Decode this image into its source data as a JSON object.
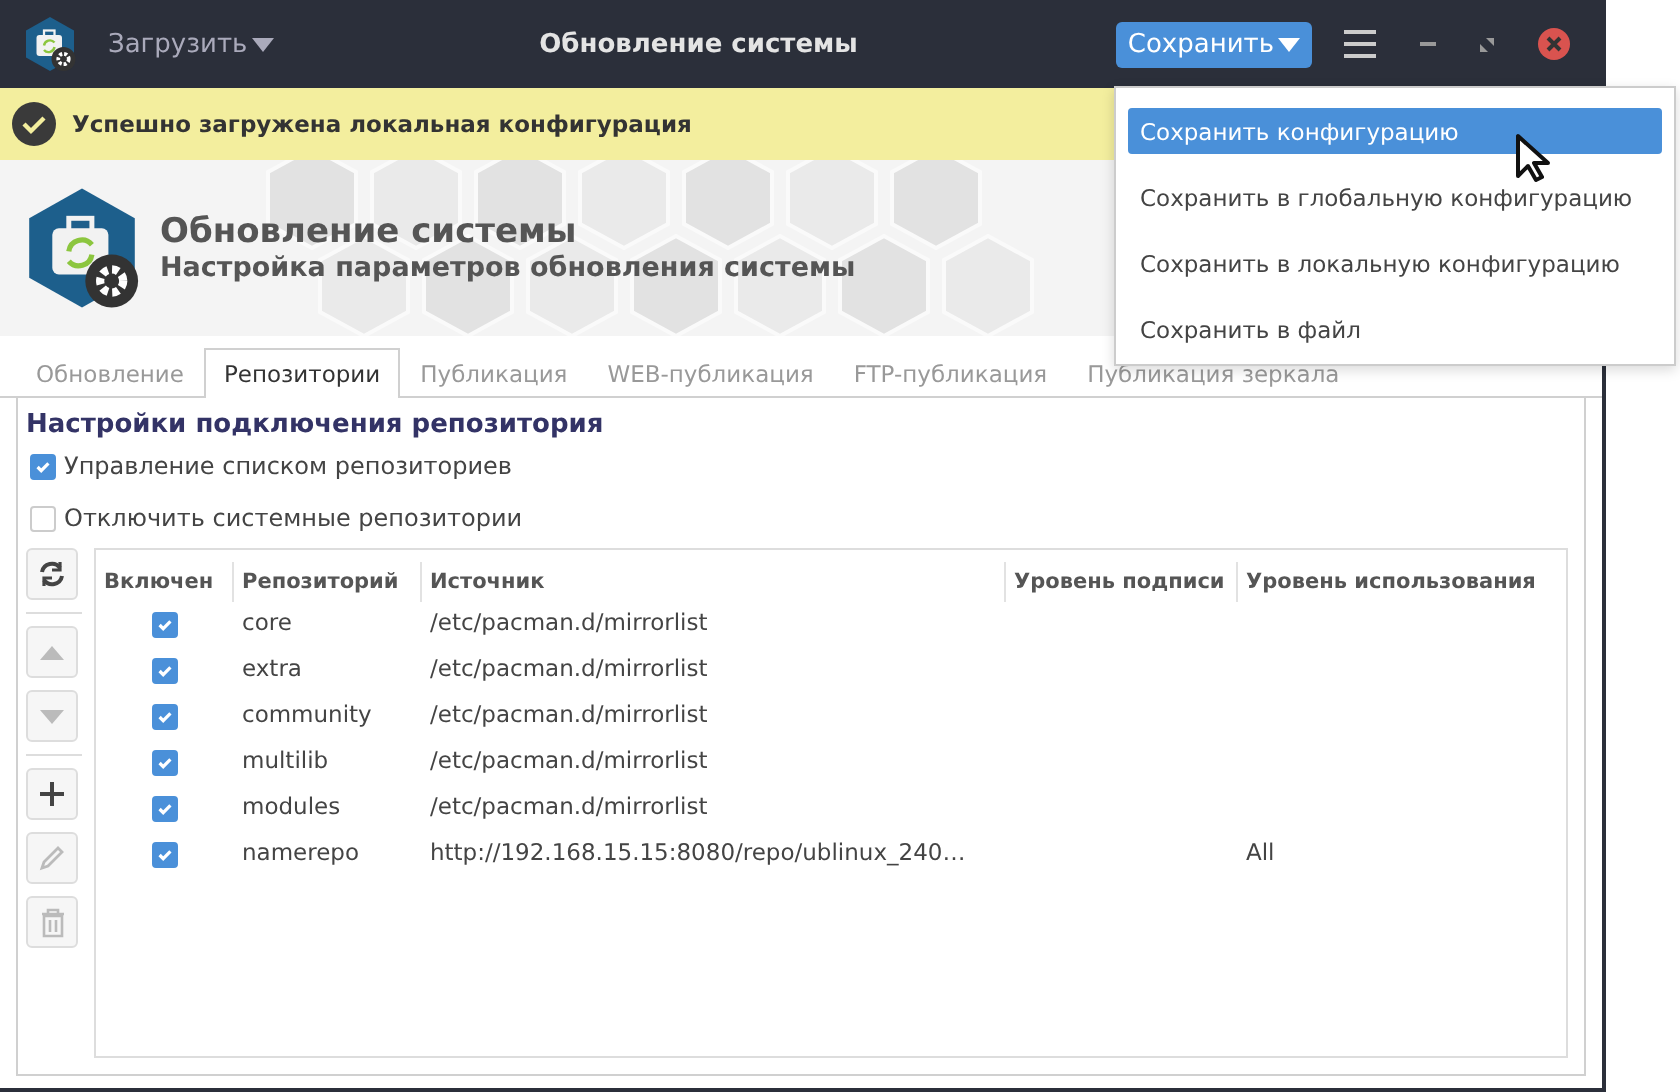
{
  "window": {
    "title": "Обновление системы",
    "load_button": "Загрузить",
    "save_button": "Сохранить"
  },
  "notification": {
    "text": "Успешно загружена локальная конфигурация"
  },
  "header": {
    "title": "Обновление системы",
    "subtitle": "Настройка параметров обновления системы"
  },
  "tabs": [
    {
      "label": "Обновление",
      "selected": false
    },
    {
      "label": "Репозитории",
      "selected": true
    },
    {
      "label": "Публикация",
      "selected": false
    },
    {
      "label": "WEB-публикация",
      "selected": false
    },
    {
      "label": "FTP-публикация",
      "selected": false
    },
    {
      "label": "Публикация зеркала",
      "selected": false
    }
  ],
  "save_menu": {
    "items": [
      {
        "label": "Сохранить конфигурацию",
        "selected": true
      },
      {
        "label": "Сохранить в глобальную конфигурацию",
        "selected": false
      },
      {
        "label": "Сохранить в локальную конфигурацию",
        "selected": false
      },
      {
        "label": "Сохранить в файл",
        "selected": false
      }
    ]
  },
  "section_title": "Настройки подключения репозитория",
  "options": [
    {
      "label": "Управление списком репозиториев",
      "checked": true
    },
    {
      "label": "Отключить системные репозитории",
      "checked": false
    }
  ],
  "toolbar": [
    {
      "kind": "refresh",
      "disabled": false
    },
    {
      "kind": "up",
      "disabled": true
    },
    {
      "kind": "down",
      "disabled": true
    },
    {
      "kind": "add",
      "disabled": false
    },
    {
      "kind": "edit",
      "disabled": true
    },
    {
      "kind": "delete",
      "disabled": true
    }
  ],
  "table": {
    "columns": [
      "Включен",
      "Репозиторий",
      "Источник",
      "Уровень подписи",
      "Уровень использования"
    ],
    "rows": [
      {
        "enabled": true,
        "repository": "core",
        "source": "/etc/pacman.d/mirrorlist"
      },
      {
        "enabled": true,
        "repository": "extra",
        "source": "/etc/pacman.d/mirrorlist"
      },
      {
        "enabled": true,
        "repository": "community",
        "source": "/etc/pacman.d/mirrorlist"
      },
      {
        "enabled": true,
        "repository": "multilib",
        "source": "/etc/pacman.d/mirrorlist"
      },
      {
        "enabled": true,
        "repository": "modules",
        "source": "/etc/pacman.d/mirrorlist"
      },
      {
        "enabled": true,
        "repository": "namerepo",
        "source": "http://192.168.15.15:8080/repo/ublinux_240…",
        "usage_level": "All"
      }
    ]
  }
}
